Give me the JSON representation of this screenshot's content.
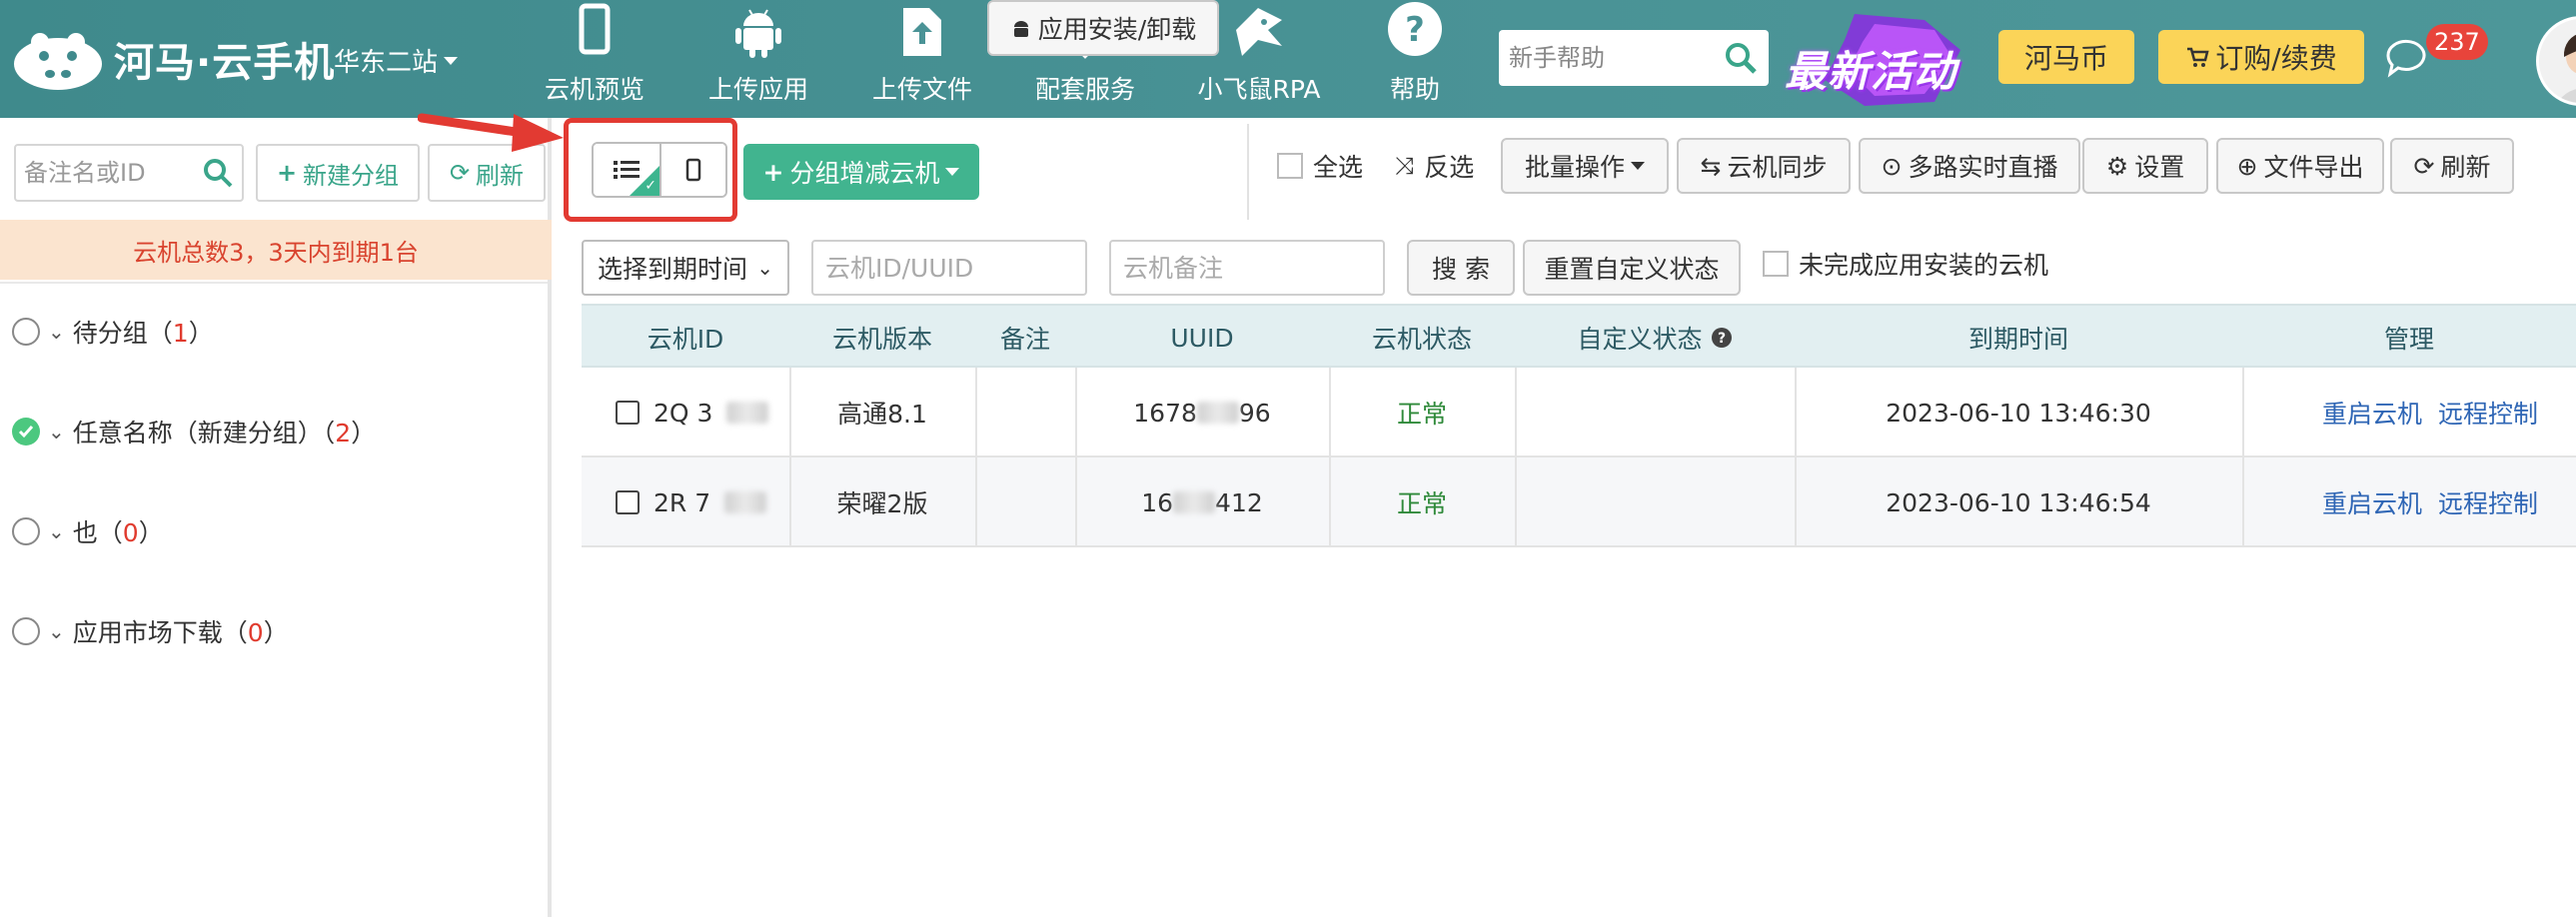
{
  "brand": {
    "logo_text": "河马·云手机",
    "station": "华东二站"
  },
  "nav": [
    {
      "label": "云机预览",
      "icon": "phone-icon"
    },
    {
      "label": "上传应用",
      "icon": "android-icon"
    },
    {
      "label": "上传文件",
      "icon": "upload-file-icon"
    },
    {
      "label": "配套服务",
      "icon": "diamond-grid-icon"
    },
    {
      "label": "小飞鼠RPA",
      "icon": "flying-squirrel-icon"
    },
    {
      "label": "帮助",
      "icon": "help-icon"
    }
  ],
  "help_search": {
    "placeholder": "新手帮助"
  },
  "promo": {
    "text": "最新活动"
  },
  "header_buttons": {
    "coin": "河马币",
    "order": "订购/续费"
  },
  "messages": {
    "count": "237"
  },
  "sidebar": {
    "search_placeholder": "备注名或ID",
    "new_group": "新建分组",
    "refresh": "刷新",
    "notice": "云机总数3，3天内到期1台",
    "groups": [
      {
        "name": "待分组（",
        "count": "1",
        "close": "）",
        "checked": false
      },
      {
        "name": "任意名称（新建分组）（",
        "count": "2",
        "close": "）",
        "checked": true
      },
      {
        "name": "也（",
        "count": "0",
        "close": "）",
        "checked": false
      },
      {
        "name": "应用市场下载（",
        "count": "0",
        "close": "）",
        "checked": false
      }
    ]
  },
  "toolbar": {
    "add_devices": "分组增减云机",
    "app_install": "应用安装/卸载",
    "select_all": "全选",
    "invert": "反选",
    "batch": "批量操作",
    "sync": "云机同步",
    "live": "多路实时直播",
    "settings": "设置",
    "export": "文件导出",
    "refresh": "刷新"
  },
  "filters": {
    "expiry_select": "选择到期时间",
    "id_placeholder": "云机ID/UUID",
    "note_placeholder": "云机备注",
    "search": "搜 索",
    "reset_status": "重置自定义状态",
    "incomplete_install": "未完成应用安装的云机"
  },
  "table": {
    "headers": [
      "云机ID",
      "云机版本",
      "备注",
      "UUID",
      "云机状态",
      "自定义状态",
      "到期时间",
      "管理"
    ],
    "rows": [
      {
        "id": "2Q 3",
        "version": "高通8.1",
        "note": "",
        "uuid_a": "1678",
        "uuid_b": "96",
        "status": "正常",
        "custom": "",
        "expiry": "2023-06-10 13:46:30",
        "action1": "重启云机",
        "action2": "远程控制"
      },
      {
        "id": "2R 7",
        "version": "荣曜2版",
        "note": "",
        "uuid_a": "16",
        "uuid_b": "412",
        "status": "正常",
        "custom": "",
        "expiry": "2023-06-10 13:46:54",
        "action1": "重启云机",
        "action2": "远程控制"
      }
    ]
  },
  "colors": {
    "header_bg": "#4a9396",
    "accent_green": "#41b48f",
    "highlight_red": "#e23a32",
    "notice_bg": "#fbe4cf",
    "table_head_bg": "#e2eff1"
  }
}
